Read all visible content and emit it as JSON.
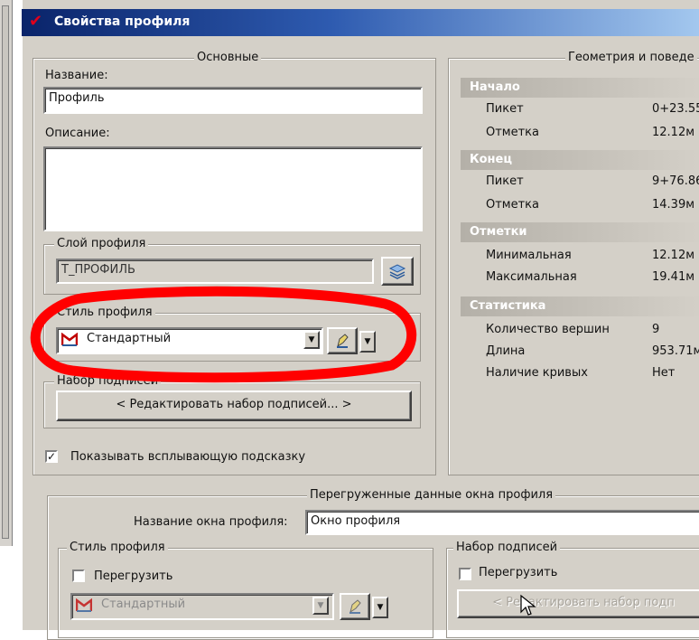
{
  "window": {
    "title": "Свойства профиля"
  },
  "basic": {
    "legend": "Основные",
    "name_label": "Название:",
    "name_value": "Профиль",
    "desc_label": "Описание:",
    "desc_value": "",
    "layer": {
      "legend": "Слой профиля",
      "value": "Т_ПРОФИЛЬ"
    },
    "style": {
      "legend": "Стиль профиля",
      "value": "Стандартный"
    },
    "labelset": {
      "legend": "Набор подписей",
      "button": "< Редактировать набор подписей... >"
    },
    "tooltip_checkbox": "Показывать всплывающую подсказку",
    "tooltip_checked": true
  },
  "geometry": {
    "legend": "Геометрия и поведе",
    "sections": [
      {
        "title": "Начало",
        "rows": [
          {
            "k": "Пикет",
            "v": "0+23.55"
          },
          {
            "k": "Отметка",
            "v": "12.12м"
          }
        ]
      },
      {
        "title": "Конец",
        "rows": [
          {
            "k": "Пикет",
            "v": "9+76.86"
          },
          {
            "k": "Отметка",
            "v": "14.39м"
          }
        ]
      },
      {
        "title": "Отметки",
        "rows": [
          {
            "k": "Минимальная",
            "v": "12.12м"
          },
          {
            "k": "Максимальная",
            "v": "19.41м"
          }
        ]
      },
      {
        "title": "Статистика",
        "rows": [
          {
            "k": "Количество вершин",
            "v": "9"
          },
          {
            "k": "Длина",
            "v": "953.71м"
          },
          {
            "k": "Наличие кривых",
            "v": "Нет"
          }
        ]
      }
    ]
  },
  "override": {
    "legend": "Перегруженные данные окна профиля",
    "window_name_label": "Название окна профиля:",
    "window_name_value": "Окно профиля",
    "style": {
      "legend": "Стиль профиля",
      "checkbox": "Перегрузить",
      "value": "Стандартный"
    },
    "labelset": {
      "legend": "Набор подписей",
      "checkbox": "Перегрузить",
      "button": "< Редактировать набор подп"
    }
  },
  "colors": {
    "annotation": "#ff0000",
    "titlebar_start": "#0a246a",
    "titlebar_end": "#a6caf0"
  }
}
